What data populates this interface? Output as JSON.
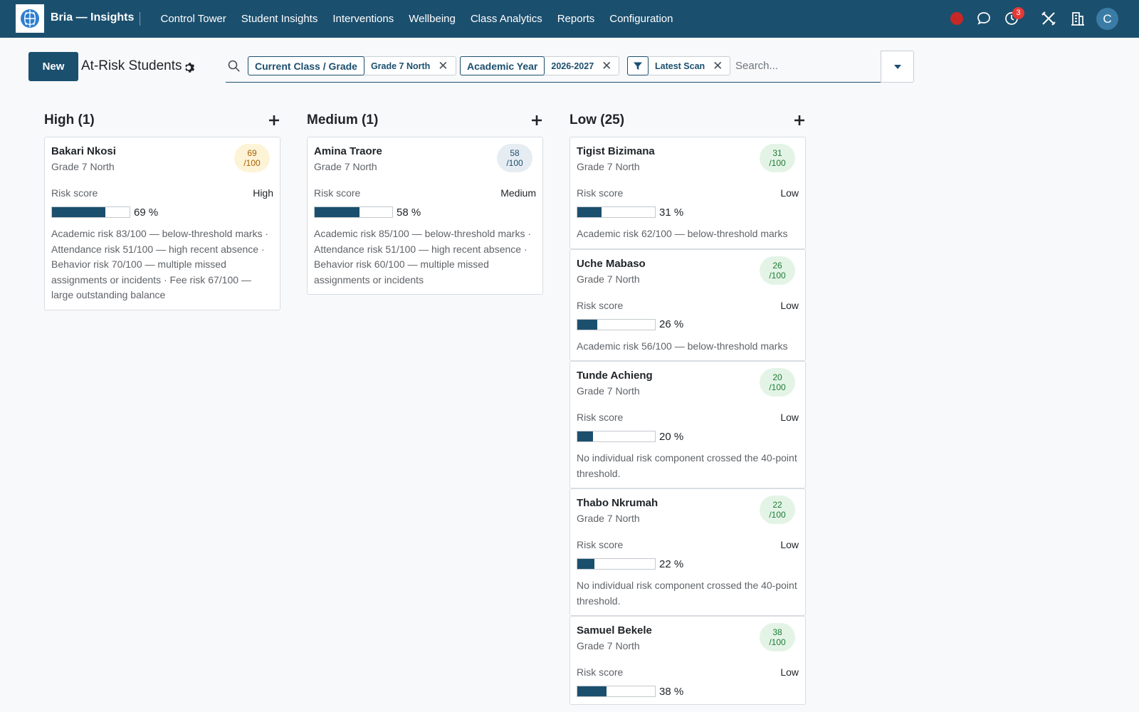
{
  "app": {
    "name": "Bria — Insights"
  },
  "nav": {
    "items": [
      "Control Tower",
      "Student Insights",
      "Interventions",
      "Wellbeing",
      "Class Analytics",
      "Reports",
      "Configuration"
    ],
    "notification_count": "3",
    "user_initial": "C"
  },
  "toolbar": {
    "new_label": "New",
    "title": "At-Risk Students"
  },
  "search": {
    "placeholder": "Search...",
    "facets": [
      {
        "label": "Current Class / Grade",
        "value": "Grade 7 North"
      },
      {
        "label": "Academic Year",
        "value": "2026-2027"
      },
      {
        "label": "",
        "value": "Latest Scan",
        "icon": "filter-icon"
      }
    ]
  },
  "columns": [
    {
      "title": "High (1)",
      "cards": [
        {
          "name": "Bakari Nkosi",
          "grade": "Grade 7 North",
          "score": "69",
          "score_suffix": "/100",
          "risk_label": "Risk score",
          "risk_level": "High",
          "progress": 69,
          "progress_text": "69 %",
          "badge": "high",
          "desc": "Academic risk 83/100 — below-threshold marks · Attendance risk 51/100 — high recent absence · Behavior risk 70/100 — multiple missed assignments or incidents · Fee risk 67/100 — large outstanding balance"
        }
      ]
    },
    {
      "title": "Medium (1)",
      "cards": [
        {
          "name": "Amina Traore",
          "grade": "Grade 7 North",
          "score": "58",
          "score_suffix": "/100",
          "risk_label": "Risk score",
          "risk_level": "Medium",
          "progress": 58,
          "progress_text": "58 %",
          "badge": "medium",
          "desc": "Academic risk 85/100 — below-threshold marks · Attendance risk 51/100 — high recent absence · Behavior risk 60/100 — multiple missed assignments or incidents"
        }
      ]
    },
    {
      "title": "Low (25)",
      "cards": [
        {
          "name": "Tigist Bizimana",
          "grade": "Grade 7 North",
          "score": "31",
          "score_suffix": "/100",
          "risk_label": "Risk score",
          "risk_level": "Low",
          "progress": 31,
          "progress_text": "31 %",
          "badge": "low",
          "desc": "Academic risk 62/100 — below-threshold marks"
        },
        {
          "name": "Uche Mabaso",
          "grade": "Grade 7 North",
          "score": "26",
          "score_suffix": "/100",
          "risk_label": "Risk score",
          "risk_level": "Low",
          "progress": 26,
          "progress_text": "26 %",
          "badge": "low",
          "desc": "Academic risk 56/100 — below-threshold marks"
        },
        {
          "name": "Tunde Achieng",
          "grade": "Grade 7 North",
          "score": "20",
          "score_suffix": "/100",
          "risk_label": "Risk score",
          "risk_level": "Low",
          "progress": 20,
          "progress_text": "20 %",
          "badge": "low",
          "desc": "No individual risk component crossed the 40-point threshold."
        },
        {
          "name": "Thabo Nkrumah",
          "grade": "Grade 7 North",
          "score": "22",
          "score_suffix": "/100",
          "risk_label": "Risk score",
          "risk_level": "Low",
          "progress": 22,
          "progress_text": "22 %",
          "badge": "low",
          "desc": "No individual risk component crossed the 40-point threshold."
        },
        {
          "name": "Samuel Bekele",
          "grade": "Grade 7 North",
          "score": "38",
          "score_suffix": "/100",
          "risk_label": "Risk score",
          "risk_level": "Low",
          "progress": 38,
          "progress_text": "38 %",
          "badge": "low",
          "desc": ""
        }
      ]
    }
  ],
  "colors": {
    "primary": "#1b4f6e",
    "record": "#c62828",
    "badge_high_bg": "#fdf3d6",
    "badge_medium_bg": "#e6edf2",
    "badge_low_bg": "#e3f4e6"
  }
}
